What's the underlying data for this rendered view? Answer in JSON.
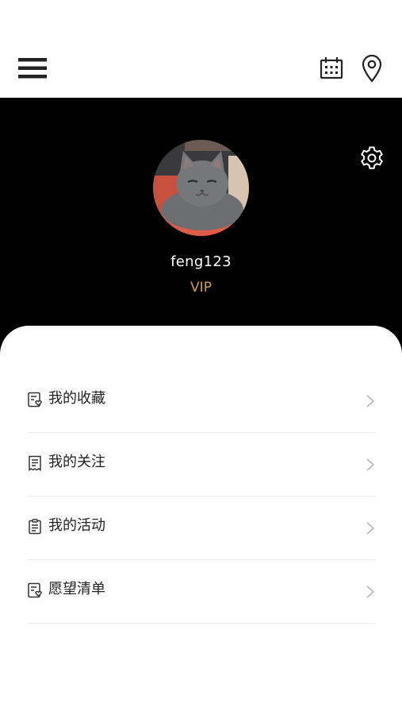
{
  "topbar": {
    "menu_icon": "hamburger-menu-icon",
    "calendar_icon": "calendar-icon",
    "location_icon": "location-pin-icon"
  },
  "profile": {
    "settings_icon": "gear-icon",
    "avatar": "gray-cat-photo",
    "username": "feng123",
    "membership": "VIP"
  },
  "colors": {
    "header_bg": "#000000",
    "vip_gold": "#c9a052",
    "text_dark": "#222222",
    "divider": "#e9e9e9"
  },
  "menu": {
    "items": [
      {
        "label": "我的收藏",
        "icon": "favorites-list-icon"
      },
      {
        "label": "我的关注",
        "icon": "receipt-icon"
      },
      {
        "label": "我的活动",
        "icon": "clipboard-icon"
      },
      {
        "label": "愿望清单",
        "icon": "wishlist-icon"
      }
    ]
  }
}
